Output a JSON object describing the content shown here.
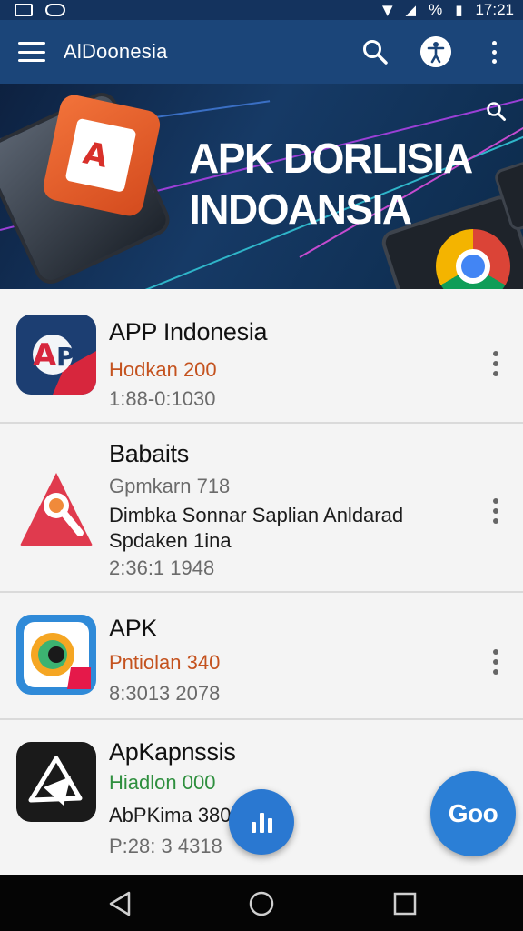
{
  "status_bar": {
    "time": "17:21",
    "percent_glyph": "%",
    "icons": [
      "image-icon",
      "eye-icon",
      "wifi-icon",
      "signal-icon",
      "battery-icon"
    ]
  },
  "appbar": {
    "title": "AlDoonesia",
    "icons": [
      "menu-icon",
      "search-icon",
      "accessibility-icon",
      "more-vert-icon"
    ],
    "color": "#1b4579"
  },
  "banner": {
    "heading_line1": "APK DORLISIA",
    "heading_line2": "INDOANSIA",
    "app_mark": "A"
  },
  "apps": [
    {
      "name": "APP Indonesia",
      "icon_text": "AD",
      "line1": "Hodkan 200",
      "line2": "1:88-0:1030"
    },
    {
      "name": "Babaits",
      "line1": "Gpmkarn 718",
      "line2": "Dimbka  Sonnar Saplian Anldarad",
      "line3": "Spdaken 1ina",
      "line4": "2:36:1 1948"
    },
    {
      "name": "APK",
      "line1": "Pntiolan 340",
      "line2": "8:3013 2078"
    },
    {
      "name": "ApKapnssis",
      "line1": "Hiadlon 000",
      "line2": "AbPKima 380",
      "line3": "P:28: 3 4318"
    }
  ],
  "fab_large": {
    "label": "Goo"
  },
  "navbar": {
    "icons": [
      "back-icon",
      "home-icon",
      "recents-icon"
    ]
  },
  "colors": {
    "accent": "#2b7fd6",
    "statusbar": "#14335e",
    "orange_text": "#c4521e",
    "green_text": "#2e8f3e"
  }
}
